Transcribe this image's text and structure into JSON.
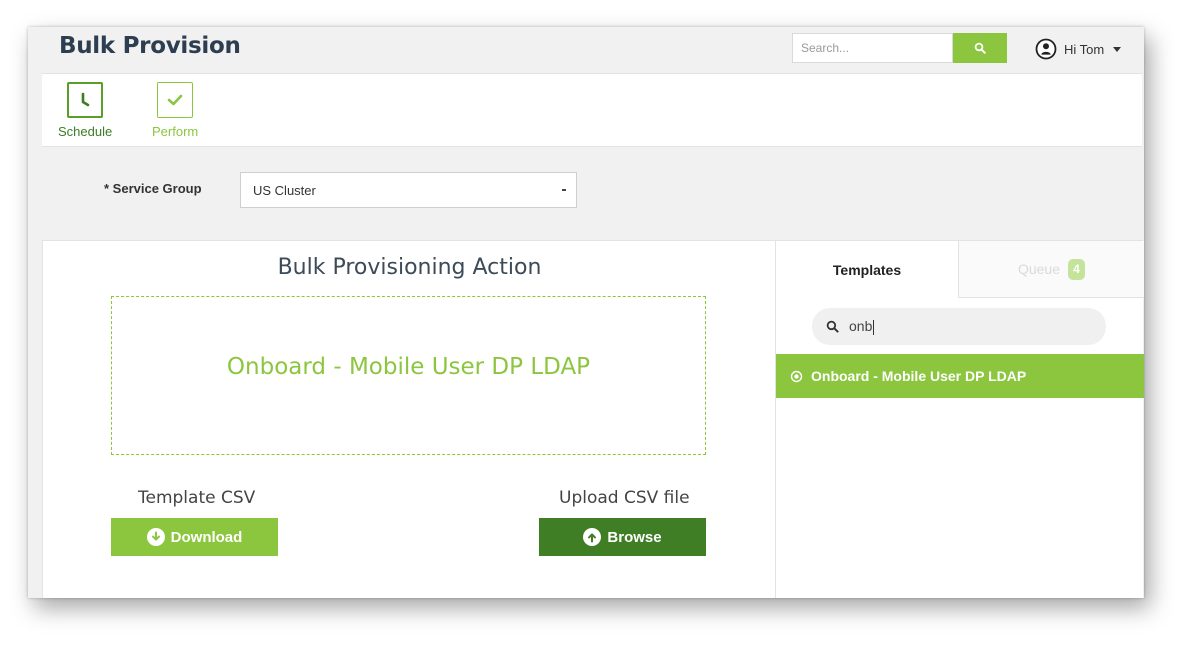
{
  "header": {
    "title": "Bulk Provision",
    "search_placeholder": "Search...",
    "user_name": "Hi Tom"
  },
  "toolbar": {
    "tools": [
      {
        "label": "Schedule",
        "icon": "clock-icon"
      },
      {
        "label": "Perform",
        "icon": "checkmark-icon"
      }
    ]
  },
  "service_group": {
    "label": "* Service Group",
    "selected": "US Cluster"
  },
  "main": {
    "title": "Bulk Provisioning Action",
    "selected_template": "Onboard - Mobile User DP LDAP",
    "template_csv_label": "Template CSV",
    "download_label": "Download",
    "upload_csv_label": "Upload CSV file",
    "browse_label": "Browse"
  },
  "side": {
    "tabs": {
      "templates": "Templates",
      "queue": "Queue",
      "queue_count": "4"
    },
    "search_value": "onb",
    "results": [
      {
        "label": "Onboard - Mobile User DP LDAP"
      }
    ]
  },
  "colors": {
    "accent_green": "#8cc63f",
    "dark_green": "#3f7e25",
    "title_text": "#2c3e50"
  }
}
